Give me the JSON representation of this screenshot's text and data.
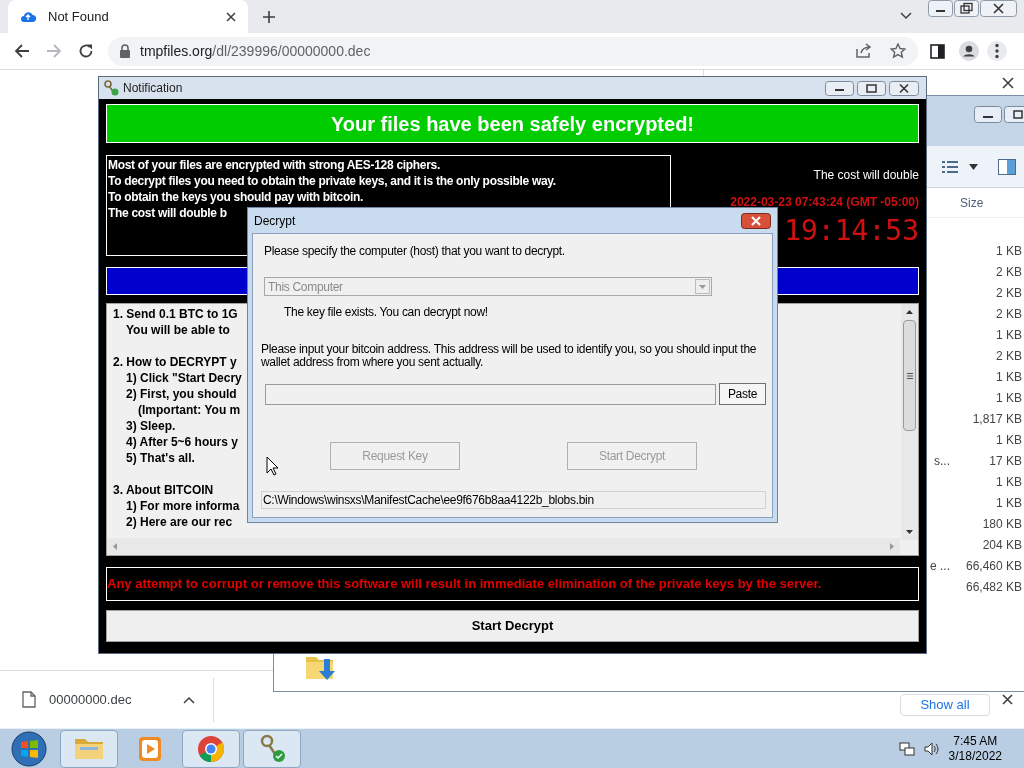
{
  "browser": {
    "tabs": [
      {
        "title": "Not Found",
        "selected": true
      }
    ],
    "url": {
      "host": "tmpfiles.org",
      "path": "/dl/239996/00000000.dec"
    },
    "forward_button": {
      "disabled": true
    }
  },
  "explorer": {
    "size_header": "Size",
    "rows": [
      {
        "size": "1 KB"
      },
      {
        "size": "2 KB"
      },
      {
        "size": "2 KB"
      },
      {
        "size": "2 KB"
      },
      {
        "size": "1 KB"
      },
      {
        "size": "2 KB"
      },
      {
        "size": "1 KB"
      },
      {
        "size": "1 KB"
      },
      {
        "size": "1,817 KB"
      },
      {
        "size": "1 KB"
      },
      {
        "name": "s...",
        "size": "17 KB"
      },
      {
        "size": "1 KB"
      },
      {
        "size": "1 KB"
      },
      {
        "size": "180 KB"
      },
      {
        "size": "204 KB"
      },
      {
        "name": "e ...",
        "size": "66,460 KB"
      },
      {
        "size": "66,482 KB"
      }
    ]
  },
  "notification": {
    "title": "Notification",
    "banner": "Your files have been safely encrypted!",
    "info_lines": [
      "Most of your files are encrypted with strong AES-128 ciphers.",
      "To decrypt files you need to obtain the private keys, and it is the only possible way.",
      "To obtain the keys you should pay with bitcoin.",
      "The cost will double b"
    ],
    "cost_note": "The cost will double",
    "deadline": "2022-03-23 07:43:24 (GMT -05:00)",
    "countdown": "19:14:53",
    "instructions": [
      {
        "heading": "1. Send 0.1 BTC to 1G",
        "items": [
          {
            "text": "You will be able to"
          }
        ]
      },
      {
        "heading": "2. How to DECRYPT y",
        "items": [
          {
            "text": "1) Click \"Start Decry"
          },
          {
            "text": "2) First, you should",
            "children": [
              {
                "text": "(Important: You m"
              }
            ]
          },
          {
            "text": "3) Sleep."
          },
          {
            "text": "4) After 5~6 hours y"
          },
          {
            "text": "5) That's all."
          }
        ]
      },
      {
        "heading": "3. About BITCOIN",
        "items": [
          {
            "text": "1) For more informa"
          },
          {
            "text": "2) Here are our rec"
          }
        ]
      }
    ],
    "warning": "Any attempt to corrupt or remove this software will result in immediate elimination of the private keys by the server.",
    "button": "Start Decrypt"
  },
  "decrypt_dialog": {
    "title": "Decrypt",
    "host_prompt": "Please specify the computer (host) that you want to decrypt.",
    "host_select": {
      "value": "This Computer",
      "disabled": true
    },
    "key_status": "The key file exists. You can decrypt now!",
    "address_prompt": "Please input your bitcoin address. This address will be used to identify you, so you should input the wallet address from where you sent actually.",
    "paste_button": "Paste",
    "buttons": [
      {
        "label": "Request Key",
        "disabled": true
      },
      {
        "label": "Start Decrypt",
        "disabled": true
      }
    ],
    "path": "C:\\Windows\\winsxs\\ManifestCache\\ee9f676b8aa4122b_blobs.bin"
  },
  "downloads": {
    "file": "00000000.dec",
    "show_all": "Show all"
  },
  "taskbar": {
    "apps": [
      {
        "kind": "folder",
        "open": true
      },
      {
        "kind": "media",
        "open": false
      },
      {
        "kind": "chrome",
        "open": true
      },
      {
        "kind": "keys",
        "open": true
      }
    ],
    "time": "7:45 AM",
    "date": "3/18/2022"
  }
}
